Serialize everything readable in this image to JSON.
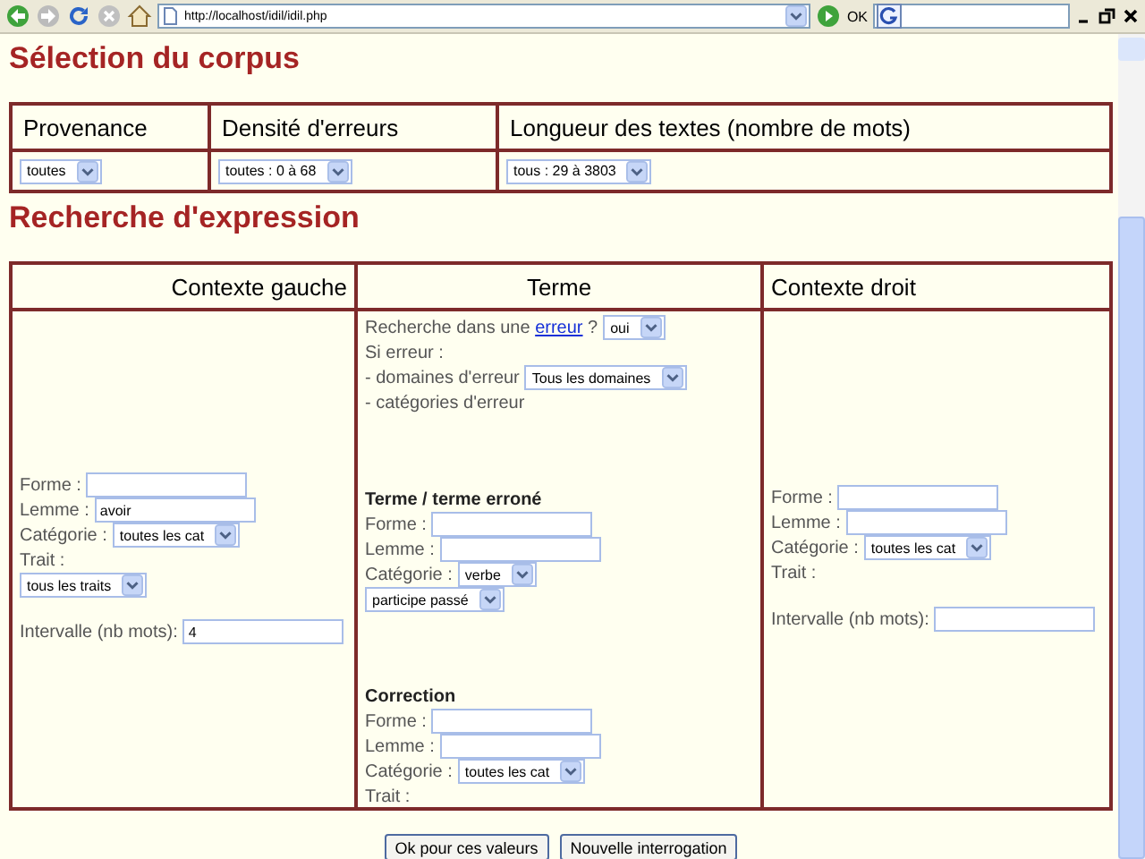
{
  "browser": {
    "address": "http://localhost/idil/idil.php",
    "go_label": "OK"
  },
  "corpus": {
    "title": "Sélection du corpus",
    "columns": [
      {
        "header": "Provenance",
        "select": "toutes"
      },
      {
        "header": "Densité d'erreurs",
        "select": "toutes : 0 à 68"
      },
      {
        "header": "Longueur des textes (nombre de mots)",
        "select": "tous : 29 à 3803"
      }
    ]
  },
  "expression": {
    "title": "Recherche d'expression",
    "columns": [
      {
        "kind": "left",
        "header": "Contexte gauche",
        "blocks": [
          [
            {
              "kind": "input",
              "label": "Forme :"
            },
            {
              "kind": "input",
              "label": "Lemme :",
              "value": "avoir"
            },
            {
              "kind": "select",
              "label": "Catégorie :",
              "value": "toutes les cat"
            },
            {
              "kind": "text",
              "text": "Trait :"
            },
            {
              "kind": "select",
              "value": "tous les traits"
            }
          ],
          [
            {
              "kind": "input",
              "label": "Intervalle (nb mots):",
              "value": "4"
            }
          ]
        ]
      },
      {
        "kind": "term",
        "header": "Terme",
        "blocks": [
          [
            {
              "kind": "query",
              "before": "Recherche dans une",
              "link": "erreur",
              "after": "?",
              "value": "oui"
            },
            {
              "kind": "text",
              "text": "Si erreur :"
            },
            {
              "kind": "select",
              "label": "- domaines d'erreur",
              "value": "Tous les domaines"
            },
            {
              "kind": "text",
              "text": "- catégories d'erreur"
            }
          ],
          [
            {
              "kind": "heading",
              "text": "Terme / terme erroné"
            },
            {
              "kind": "input",
              "label": "Forme :"
            },
            {
              "kind": "input",
              "label": "Lemme :"
            },
            {
              "kind": "select",
              "label": "Catégorie :",
              "value": "verbe"
            },
            {
              "kind": "select",
              "value": "participe passé"
            }
          ],
          [
            {
              "kind": "heading",
              "text": "Correction"
            },
            {
              "kind": "input",
              "label": "Forme :"
            },
            {
              "kind": "input",
              "label": "Lemme :"
            },
            {
              "kind": "select",
              "label": "Catégorie :",
              "value": "toutes les cat"
            },
            {
              "kind": "text",
              "text": "Trait :"
            }
          ]
        ]
      },
      {
        "kind": "right",
        "header": "Contexte droit",
        "blocks": [
          [
            {
              "kind": "input",
              "label": "Forme :"
            },
            {
              "kind": "input",
              "label": "Lemme :"
            },
            {
              "kind": "select",
              "label": "Catégorie :",
              "value": "toutes les cat"
            },
            {
              "kind": "text",
              "text": "Trait :"
            }
          ],
          [
            {
              "kind": "input",
              "label": "Intervalle (nb mots):"
            }
          ]
        ]
      }
    ]
  },
  "buttons": [
    "Ok pour ces valeurs",
    "Nouvelle interrogation"
  ]
}
